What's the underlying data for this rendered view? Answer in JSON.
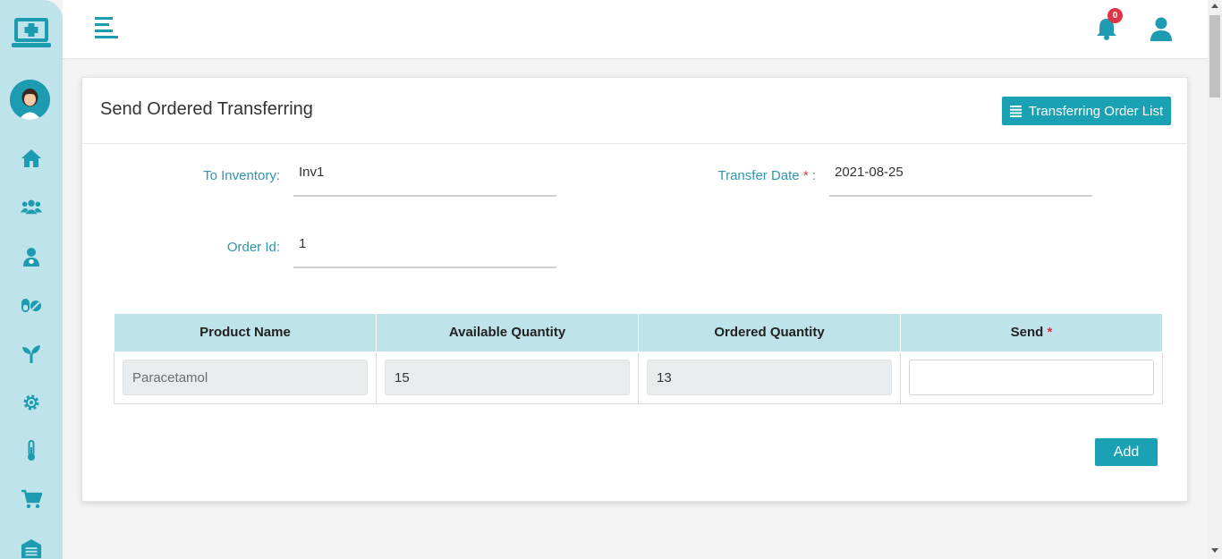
{
  "topbar": {
    "notification_count": "0"
  },
  "sidebar": {
    "items": [
      {
        "icon": "home-icon"
      },
      {
        "icon": "users-icon"
      },
      {
        "icon": "doctor-icon"
      },
      {
        "icon": "pills-icon"
      },
      {
        "icon": "seedling-icon"
      },
      {
        "icon": "gear-icon"
      },
      {
        "icon": "thermometer-icon"
      },
      {
        "icon": "cart-icon"
      },
      {
        "icon": "warehouse-icon"
      }
    ]
  },
  "card": {
    "title": "Send Ordered Transferring",
    "list_button_label": "Transferring Order List"
  },
  "form": {
    "to_inventory_label": "To Inventory:",
    "to_inventory_value": "Inv1",
    "transfer_date_label": "Transfer Date",
    "required_mark": "*",
    "transfer_date_colon": " :",
    "transfer_date_value": "2021-08-25",
    "order_id_label": "Order Id:",
    "order_id_value": "1"
  },
  "table": {
    "headers": [
      "Product Name",
      "Available Quantity",
      "Ordered Quantity",
      "Send"
    ],
    "rows": [
      {
        "product_name": "Paracetamol",
        "available_quantity": "15",
        "ordered_quantity": "13",
        "send": ""
      }
    ]
  },
  "actions": {
    "add_label": "Add"
  },
  "colors": {
    "accent": "#1ba1b4",
    "sidebar_bg": "#bfe3ea",
    "badge": "#dc3545"
  }
}
